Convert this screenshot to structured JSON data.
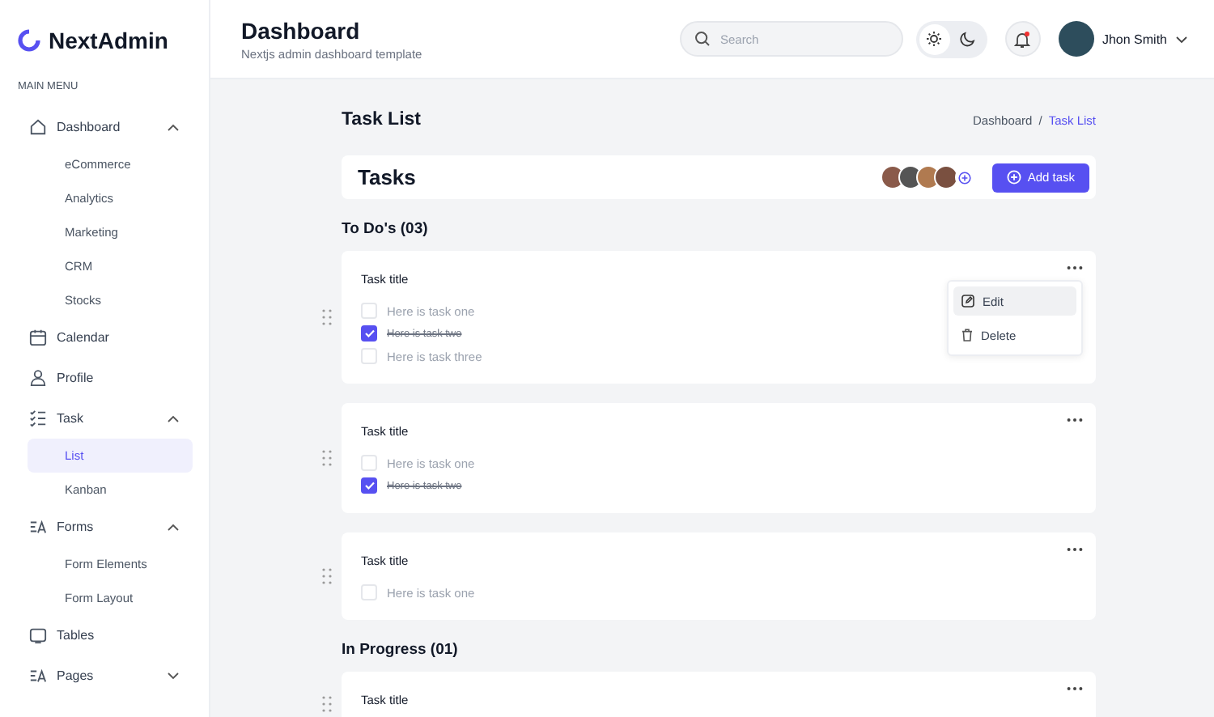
{
  "sidebar": {
    "logo": "NextAdmin",
    "section_label": "MAIN MENU",
    "items": [
      {
        "label": "Dashboard",
        "expanded": true,
        "children": [
          {
            "label": "eCommerce",
            "selected": false
          },
          {
            "label": "Analytics",
            "selected": false
          },
          {
            "label": "Marketing",
            "selected": false
          },
          {
            "label": "CRM",
            "selected": false
          },
          {
            "label": "Stocks",
            "selected": false
          }
        ]
      },
      {
        "label": "Calendar"
      },
      {
        "label": "Profile"
      },
      {
        "label": "Task",
        "expanded": true,
        "children": [
          {
            "label": "List",
            "selected": true
          },
          {
            "label": "Kanban",
            "selected": false
          }
        ]
      },
      {
        "label": "Forms",
        "expanded": true,
        "children": [
          {
            "label": "Form Elements",
            "selected": false
          },
          {
            "label": "Form Layout",
            "selected": false
          }
        ]
      },
      {
        "label": "Tables"
      },
      {
        "label": "Pages",
        "expanded": false
      }
    ]
  },
  "header": {
    "title": "Dashboard",
    "subtitle": "Nextjs admin dashboard template",
    "search": {
      "placeholder": "Search"
    },
    "theme_toggle": [
      {
        "kind": "sun",
        "selected": true
      },
      {
        "kind": "moon",
        "selected": false
      }
    ],
    "notifications": {
      "has_unread": true
    },
    "user": {
      "name": "Jhon Smith"
    }
  },
  "page": {
    "title": "Task List",
    "breadcrumb": [
      {
        "label": "Dashboard",
        "selected": false
      },
      {
        "label": "Task List",
        "selected": true
      }
    ],
    "breadcrumb_separator": "/",
    "tasks_bar": {
      "title": "Tasks",
      "add_button": "Add task"
    },
    "sections": [
      {
        "title": "To Do's (03)",
        "cards": [
          {
            "title": "Task title",
            "menu_open": true,
            "menu": [
              "Edit",
              "Delete"
            ],
            "tasks": [
              {
                "text": "Here is task one",
                "checked": false
              },
              {
                "text": "Here is task two",
                "checked": true
              },
              {
                "text": "Here is task three",
                "checked": false
              }
            ]
          },
          {
            "title": "Task title",
            "tasks": [
              {
                "text": "Here is task one",
                "checked": false
              },
              {
                "text": "Here is task two",
                "checked": true
              }
            ]
          },
          {
            "title": "Task title",
            "tasks": [
              {
                "text": "Here is task one",
                "checked": false
              }
            ]
          }
        ]
      },
      {
        "title": "In Progress (01)",
        "cards": [
          {
            "title": "Task title"
          }
        ]
      }
    ]
  }
}
